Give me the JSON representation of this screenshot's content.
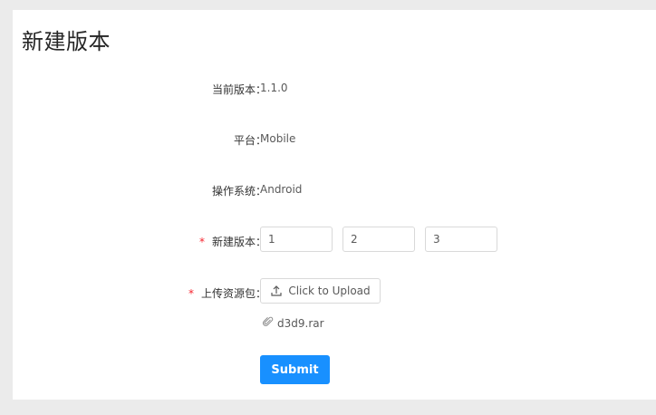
{
  "page": {
    "title": "新建版本"
  },
  "form": {
    "current_version": {
      "label": "当前版本：",
      "value": "1.1.0"
    },
    "platform": {
      "label": "平台：",
      "value": "Mobile"
    },
    "os": {
      "label": "操作系统：",
      "value": "Android"
    },
    "new_version": {
      "required_mark": "*",
      "label": "新建版本：",
      "parts": [
        "1",
        "2",
        "3"
      ]
    },
    "upload": {
      "required_mark": "*",
      "label": "上传资源包：",
      "button_label": "Click to Upload",
      "button_icon": "upload-icon",
      "file_name": "d3d9.rar",
      "file_icon": "paperclip-icon"
    },
    "submit_label": "Submit"
  },
  "colors": {
    "primary": "#1890ff",
    "required": "#f5222d",
    "background": "#ebebeb",
    "border": "#d9d9d9"
  }
}
